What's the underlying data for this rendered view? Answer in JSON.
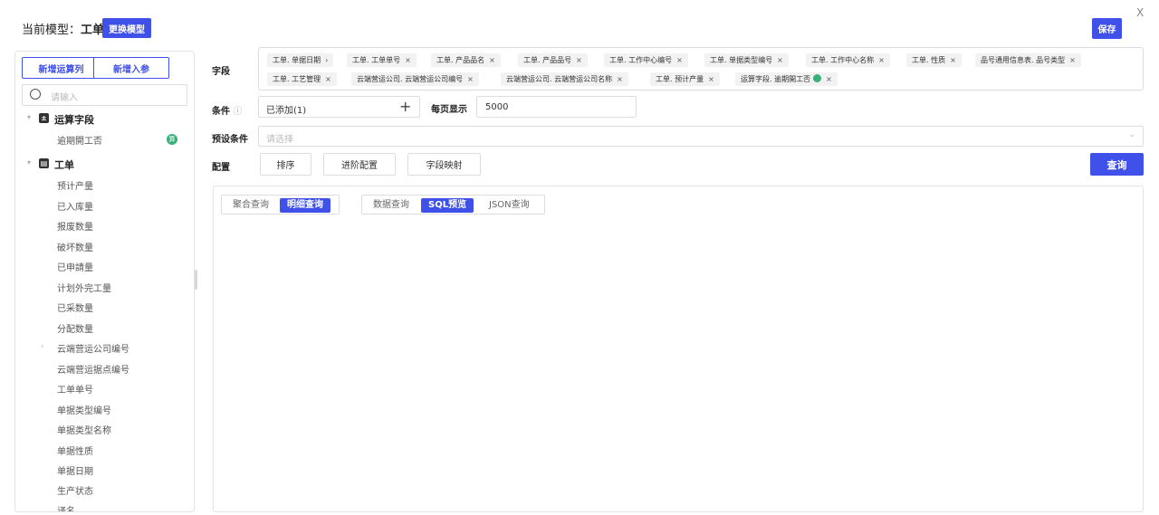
{
  "header": {
    "model_prefix": "当前模型：",
    "model_name": "工单",
    "change_model_label": "更换模型",
    "save_label": "保存",
    "close_label": "X"
  },
  "sidebar": {
    "add_calc_label": "新增运算列",
    "add_param_label": "新增入参",
    "search_placeholder": "请输入",
    "groups": [
      {
        "label": "运算字段",
        "icon": "calc-field-icon",
        "items": [
          {
            "label": "逾期開工否",
            "badge": "算"
          }
        ]
      },
      {
        "label": "工单",
        "icon": "table-icon",
        "items": [
          {
            "label": "预计产量"
          },
          {
            "label": "已入库量"
          },
          {
            "label": "报废数量"
          },
          {
            "label": "破坏数量"
          },
          {
            "label": "已申請量"
          },
          {
            "label": "计划外完工量"
          },
          {
            "label": "已采数量"
          },
          {
            "label": "分配数量"
          },
          {
            "label": "云端营运公司编号",
            "expandable": true
          },
          {
            "label": "云端营运据点编号"
          },
          {
            "label": "工单单号"
          },
          {
            "label": "单据类型编号"
          },
          {
            "label": "单据类型名称"
          },
          {
            "label": "单据性质"
          },
          {
            "label": "单据日期"
          },
          {
            "label": "生产状态"
          },
          {
            "label": "译名"
          }
        ]
      }
    ]
  },
  "form": {
    "fields_label": "字段",
    "condition_label": "条件",
    "condition_value": "已添加(1)",
    "page_size_label": "每页显示",
    "page_size_value": "5000",
    "preset_label": "预设条件",
    "preset_placeholder": "请选择",
    "config_label": "配置",
    "sort_label": "排序",
    "advanced_label": "进阶配置",
    "mapping_label": "字段映射",
    "query_label": "查询",
    "chips": [
      {
        "label": "工单. 单据日期",
        "end": "›"
      },
      {
        "label": "工单. 工单单号",
        "end": "×"
      },
      {
        "label": "工单. 产品品名",
        "end": "×"
      },
      {
        "label": "工单. 产品品号",
        "end": "×"
      },
      {
        "label": "工单. 工作中心编号",
        "end": "×"
      },
      {
        "label": "工单. 单据类型编号",
        "end": "×"
      },
      {
        "label": "工单. 工作中心名称",
        "end": "×"
      },
      {
        "label": "工单. 性质",
        "end": "×"
      },
      {
        "label": "品号通用信息表. 品号类型",
        "end": "×"
      },
      {
        "label": "工单. 工艺管理",
        "end": "×"
      },
      {
        "label": "云端营运公司. 云端营运公司编号",
        "end": "×"
      },
      {
        "label": "云端营运公司. 云端营运公司名称",
        "end": "×"
      },
      {
        "label": "工单. 预计产量",
        "end": "×"
      },
      {
        "label": "运算字段. 逾期開工否",
        "end": "×"
      }
    ]
  },
  "result": {
    "mode_tabs": [
      "聚合查询",
      "明细查询"
    ],
    "view_tabs": [
      "数据查询",
      "SQL预览",
      "JSON查询"
    ]
  }
}
